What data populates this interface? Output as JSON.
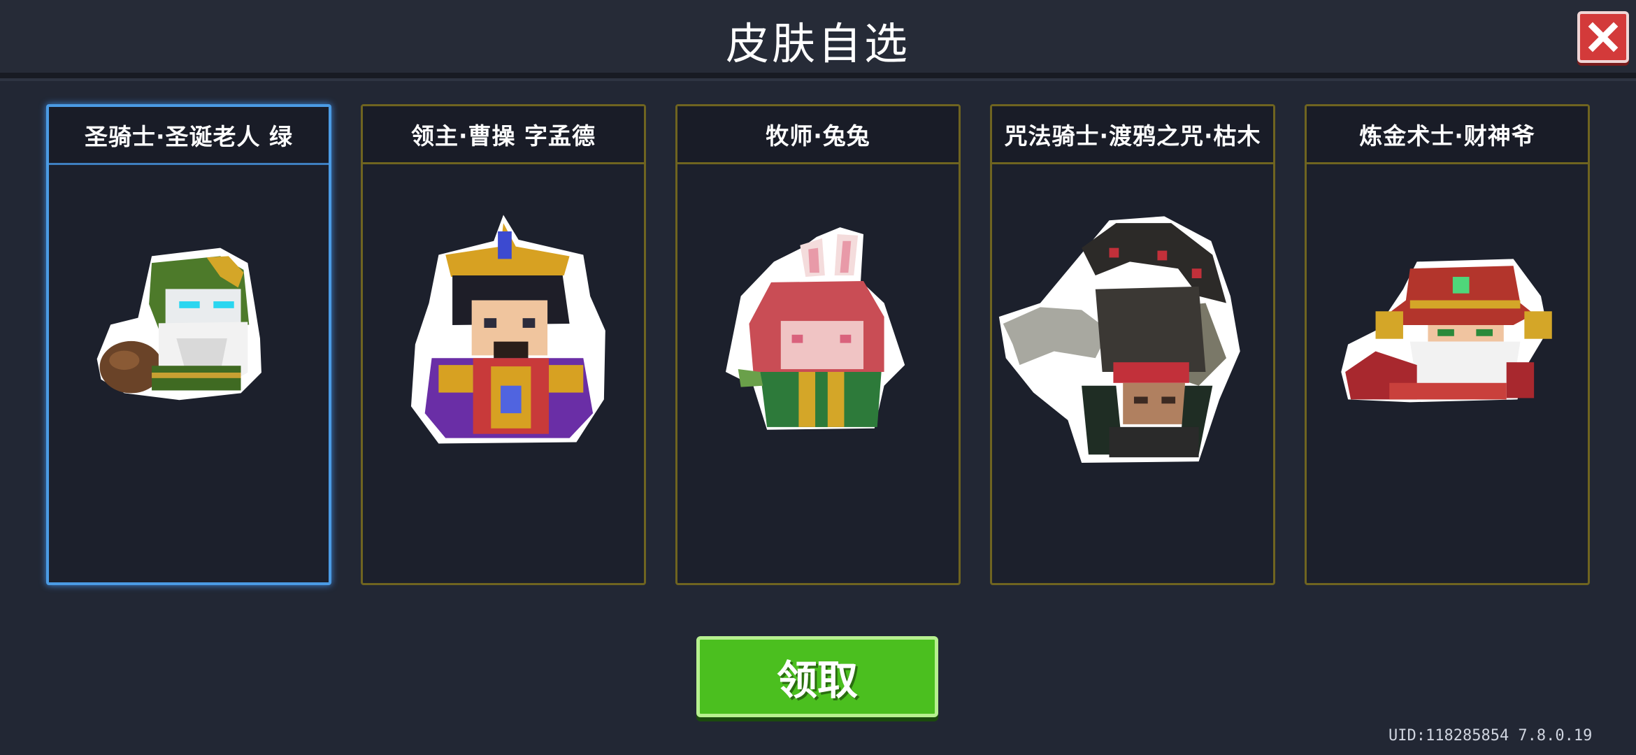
{
  "header": {
    "title": "皮肤自选"
  },
  "close_button": {
    "icon": "close-icon",
    "label": ""
  },
  "cards": [
    {
      "label": "圣骑士·圣诞老人 绿",
      "selected": true
    },
    {
      "label": "领主·曹操 字孟德",
      "selected": false
    },
    {
      "label": "牧师·兔兔",
      "selected": false
    },
    {
      "label": "咒法骑士·渡鸦之咒·枯木",
      "selected": false
    },
    {
      "label": "炼金术士·财神爷",
      "selected": false
    }
  ],
  "claim_button": {
    "label": "领取"
  },
  "footer": {
    "uid": "UID:118285854 7.8.0.19"
  },
  "colors": {
    "accent_green": "#4bbf1f",
    "selected_border": "#4b9be4",
    "card_border": "#6f6420",
    "close_red": "#d33a3a"
  }
}
